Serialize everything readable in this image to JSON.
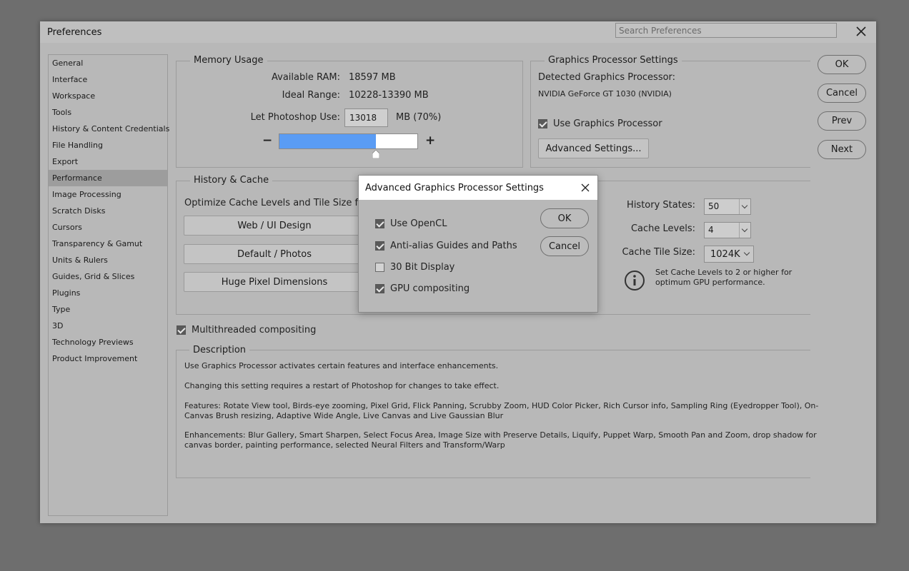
{
  "window": {
    "title": "Preferences",
    "search_placeholder": "Search Preferences"
  },
  "sidebar": {
    "items": [
      {
        "label": "General"
      },
      {
        "label": "Interface"
      },
      {
        "label": "Workspace"
      },
      {
        "label": "Tools"
      },
      {
        "label": "History & Content Credentials"
      },
      {
        "label": "File Handling"
      },
      {
        "label": "Export"
      },
      {
        "label": "Performance",
        "active": true
      },
      {
        "label": "Image Processing"
      },
      {
        "label": "Scratch Disks"
      },
      {
        "label": "Cursors"
      },
      {
        "label": "Transparency & Gamut"
      },
      {
        "label": "Units & Rulers"
      },
      {
        "label": "Guides, Grid & Slices"
      },
      {
        "label": "Plugins"
      },
      {
        "label": "Type"
      },
      {
        "label": "3D"
      },
      {
        "label": "Technology Previews"
      },
      {
        "label": "Product Improvement"
      }
    ]
  },
  "memory": {
    "title": "Memory Usage",
    "available_label": "Available RAM:",
    "available_value": "18597 MB",
    "ideal_label": "Ideal Range:",
    "ideal_value": "10228-13390 MB",
    "let_use_label": "Let Photoshop Use:",
    "let_use_value": "13018",
    "let_use_suffix": "MB (70%)",
    "slider_fraction": 0.7,
    "minus": "−",
    "plus": "+"
  },
  "gpu": {
    "title": "Graphics Processor Settings",
    "detected_label": "Detected Graphics Processor:",
    "detected_value": "NVIDIA GeForce GT 1030 (NVIDIA)",
    "use_gpu_label": "Use Graphics Processor",
    "use_gpu_checked": true,
    "advanced_button": "Advanced Settings..."
  },
  "actions": {
    "ok": "OK",
    "cancel": "Cancel",
    "prev": "Prev",
    "next": "Next"
  },
  "history_cache": {
    "title": "History & Cache",
    "optimize_label": "Optimize Cache Levels and Tile Size for:",
    "buttons": [
      "Web / UI Design",
      "Default / Photos",
      "Huge Pixel Dimensions"
    ],
    "history_states_label": "History States:",
    "history_states_value": "50",
    "cache_levels_label": "Cache Levels:",
    "cache_levels_value": "4",
    "cache_tile_label": "Cache Tile Size:",
    "cache_tile_value": "1024K",
    "info_text_1": "Set Cache Levels to 2 or higher for",
    "info_text_2": "optimum GPU performance."
  },
  "multithreaded": {
    "label": "Multithreaded compositing",
    "checked": true
  },
  "description": {
    "title": "Description",
    "p1": "Use Graphics Processor activates certain features and interface enhancements.",
    "p2": "Changing this setting requires a restart of Photoshop for changes to take effect.",
    "p3_line1": "Features: Rotate View tool, Birds-eye zooming, Pixel Grid, Flick Panning, Scrubby Zoom, HUD Color Picker, Rich Cursor info, Sampling Ring (Eyedropper Tool), On-",
    "p3_line2": "Canvas Brush resizing, Adaptive Wide Angle, Live Canvas and Live Gaussian Blur",
    "p4_line1": "Enhancements: Blur Gallery, Smart Sharpen, Select Focus Area, Image Size with Preserve Details, Liquify, Puppet Warp, Smooth Pan and Zoom, drop shadow for",
    "p4_line2": "canvas border, painting performance, selected Neural Filters and Transform/Warp"
  },
  "modal": {
    "title": "Advanced Graphics Processor Settings",
    "options": [
      {
        "label": "Use OpenCL",
        "checked": true
      },
      {
        "label": "Anti-alias Guides and Paths",
        "checked": true
      },
      {
        "label": "30 Bit Display",
        "checked": false
      },
      {
        "label": "GPU compositing",
        "checked": true
      }
    ],
    "ok": "OK",
    "cancel": "Cancel"
  },
  "colors": {
    "slider_fill": "#5a9cf4",
    "overlay": "#6e6e6e",
    "dialog_bg": "#b8b8b8"
  }
}
